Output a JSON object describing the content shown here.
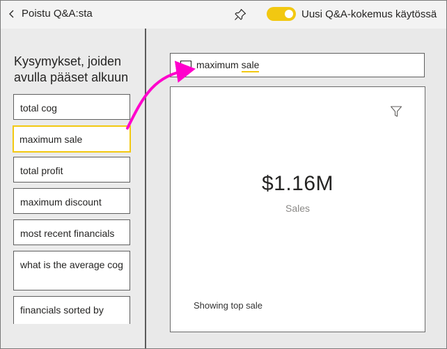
{
  "topbar": {
    "back_label": "Poistu Q&A:sta",
    "toggle_label": "Uusi Q&A-kokemus käytössä",
    "toggle_on": true
  },
  "colors": {
    "accent": "#F2C811",
    "arrow": "#FF00CC",
    "border": "#5F5F5F",
    "pane_bg": "#EBEBEB"
  },
  "left": {
    "heading": "Kysymykset, joiden avulla pääset alkuun",
    "suggestions": [
      "total cog",
      "maximum sale",
      "total profit",
      "maximum discount",
      "most recent financials",
      "what is the average cog",
      "financials sorted by"
    ],
    "active_index": 1
  },
  "main": {
    "query_words": [
      "maximum",
      "sale"
    ],
    "result": {
      "value": "$1.16M",
      "label": "Sales",
      "footnote": "Showing top sale"
    }
  },
  "icons": {
    "back": "chevron-left-icon",
    "pin": "pin-icon",
    "query": "chat-bubble-icon",
    "filter": "filter-icon"
  }
}
